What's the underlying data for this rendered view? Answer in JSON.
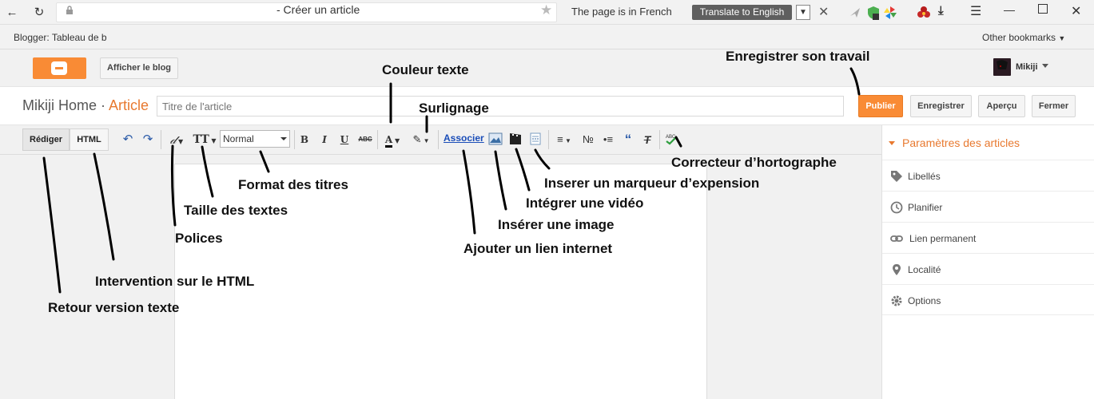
{
  "browser": {
    "tab_title": "- Créer un article",
    "translate": {
      "message": "The page is in French",
      "button": "Translate to English"
    },
    "bookmarks": {
      "first": "Blogger: Tableau de b",
      "other": "Other bookmarks"
    }
  },
  "header": {
    "view_blog": "Afficher le blog",
    "user": "Mikiji"
  },
  "title_row": {
    "blog_name": "Mikiji Home ·",
    "post_type": "Article",
    "title_placeholder": "Titre de l'article",
    "publish": "Publier",
    "save": "Enregistrer",
    "preview": "Aperçu",
    "close": "Fermer"
  },
  "toolbar": {
    "compose": "Rédiger",
    "html": "HTML",
    "format_value": "Normal",
    "bold": "B",
    "italic": "I",
    "underline": "U",
    "strikethrough": "ABC",
    "link": "Associer"
  },
  "sidebar": {
    "title": "Paramètres des articles",
    "items": [
      {
        "label": "Libellés",
        "icon": "tag-icon"
      },
      {
        "label": "Planifier",
        "icon": "clock-icon"
      },
      {
        "label": "Lien permanent",
        "icon": "link-icon"
      },
      {
        "label": "Localité",
        "icon": "pin-icon"
      },
      {
        "label": "Options",
        "icon": "gear-icon"
      }
    ]
  },
  "annotations": {
    "save_work": "Enregistrer son travail",
    "text_color": "Couleur texte",
    "highlight": "Surlignage",
    "spell_check": "Correcteur d’hortographe",
    "jump_break": "Inserer un marqueur d’expension",
    "video": "Intégrer une vidéo",
    "heading_format": "Format des titres",
    "text_size": "Taille des textes",
    "fonts": "Polices",
    "image": "Insérer une image",
    "link": "Ajouter un lien internet",
    "html_edit": "Intervention sur le HTML",
    "compose_mode": "Retour version texte"
  },
  "colors": {
    "accent": "#f98b35",
    "accent_text": "#e8792f",
    "link": "#1a4db8"
  }
}
